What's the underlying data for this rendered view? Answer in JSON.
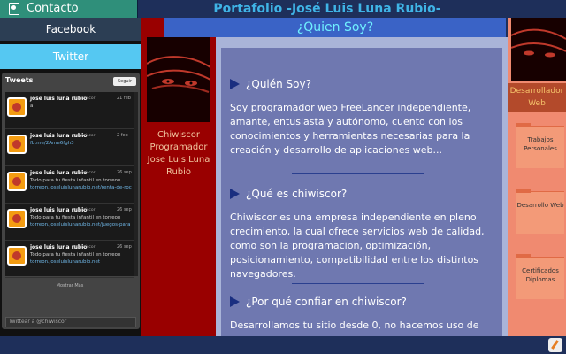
{
  "header": {
    "contact_label": "Contacto",
    "title": "Portafolio -José Luis Luna Rubio-"
  },
  "social": {
    "facebook_label": "Facebook",
    "twitter_label": "Twitter",
    "widget": {
      "title": "Tweets",
      "follow_label": "Seguir",
      "tweets": [
        {
          "name": "jose luis luna rubio",
          "handle": "@chiwiscor",
          "time": "21 feb",
          "lines": [
            {
              "text": "a",
              "link": false
            }
          ]
        },
        {
          "name": "jose luis luna rubio",
          "handle": "@chiwiscor",
          "time": "2 feb",
          "lines": [
            {
              "text": "fb.me/2Ame6fgh3",
              "link": true
            }
          ]
        },
        {
          "name": "jose luis luna rubio",
          "handle": "@chiwiscor",
          "time": "26 sep",
          "lines": [
            {
              "text": "Todo para tu fiesta infantil en torreon",
              "link": false
            },
            {
              "text": "torreon.joseluislunarubio.net/renta-de-roc",
              "link": true
            }
          ]
        },
        {
          "name": "jose luis luna rubio",
          "handle": "@chiwiscor",
          "time": "26 sep",
          "lines": [
            {
              "text": "Todo para tu fiesta infantil en torreon",
              "link": false
            },
            {
              "text": "torreon.joseluislunarubio.net/juegos-para",
              "link": true
            }
          ]
        },
        {
          "name": "jose luis luna rubio",
          "handle": "@chiwiscor",
          "time": "26 sep",
          "lines": [
            {
              "text": "Todo para tu fiesta infantil en torreon",
              "link": false
            },
            {
              "text": "torreon.joseluislunarubio.net",
              "link": true
            }
          ]
        }
      ],
      "show_more": "Mostrar Más",
      "tweet_to_placeholder": "Twittear a @chiwiscor"
    }
  },
  "profile": {
    "name": "Chiwiscor Programador Jose Luis Luna Rubio"
  },
  "page": {
    "header": "¿Quien Soy?",
    "sections": [
      {
        "heading": "¿Quién Soy?",
        "body": "Soy programador web FreeLancer independiente, amante, entusiasta y autónomo, cuento con los conocimientos y herramientas necesarias para la creación y desarrollo de aplicaciones web..."
      },
      {
        "heading": "¿Qué es chiwiscor?",
        "body": "Chiwiscor es una empresa independiente en pleno crecimiento, la cual ofrece servicios web de calidad, como son la programacion, optimización, posicionamiento, compatibilidad entre los distintos navegadores."
      },
      {
        "heading": "¿Por qué confiar en chiwiscor?",
        "body": "Desarrollamos tu sitio desde 0, no hacemos uso de"
      }
    ]
  },
  "right": {
    "label": "Desarrollador Web",
    "folders": [
      "Trabajos Personales",
      "Desarrollo Web",
      "Certificados Diplomas"
    ]
  },
  "colors": {
    "accent_title": "#3fb4e6",
    "twitter": "#55c8f2",
    "profile_column": "#990000",
    "content_panel": "#6f78b0",
    "right_column": "#f08a70"
  }
}
